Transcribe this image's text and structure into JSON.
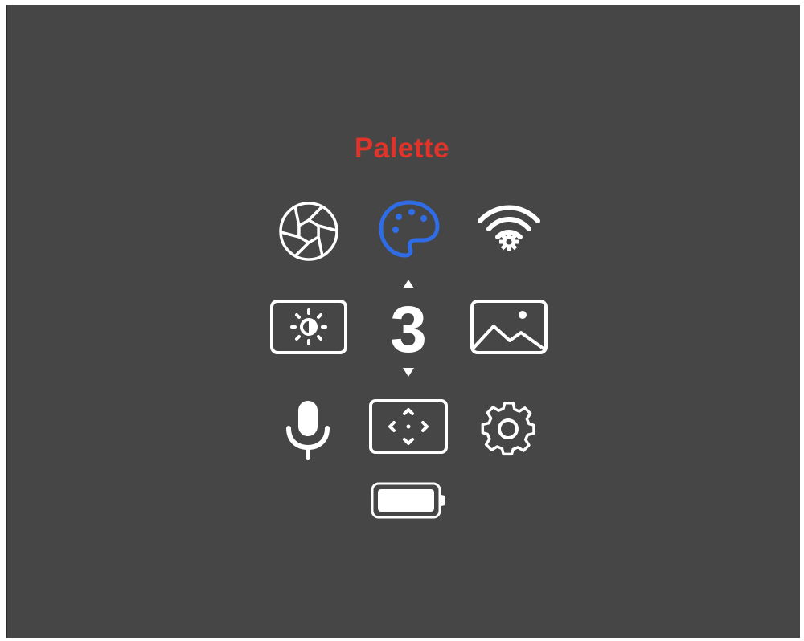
{
  "menu": {
    "title": "Palette",
    "title_color": "#e0342b",
    "selected_icon_color": "#2f6de8",
    "icon_color": "#ffffff",
    "background_color": "#464646",
    "items": [
      {
        "name": "aperture",
        "icon": "aperture-icon"
      },
      {
        "name": "palette",
        "icon": "palette-icon",
        "selected": true
      },
      {
        "name": "wifi-settings",
        "icon": "wifi-settings-icon"
      },
      {
        "name": "brightness",
        "icon": "brightness-icon"
      },
      {
        "name": "image",
        "icon": "image-icon"
      },
      {
        "name": "microphone",
        "icon": "microphone-icon"
      },
      {
        "name": "position",
        "icon": "position-icon"
      },
      {
        "name": "settings",
        "icon": "gear-icon"
      },
      {
        "name": "battery",
        "icon": "battery-icon"
      }
    ]
  },
  "palette_selector": {
    "value": "3"
  }
}
